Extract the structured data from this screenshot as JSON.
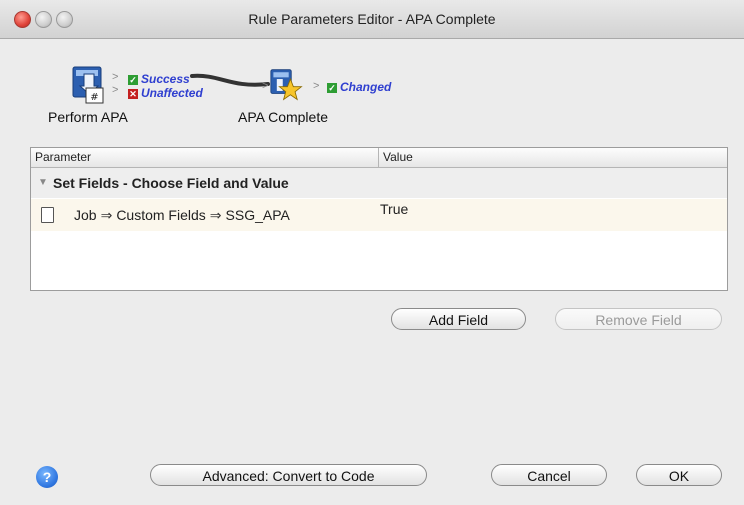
{
  "window": {
    "title": "Rule Parameters Editor - APA Complete"
  },
  "flow": {
    "source_node": "Perform APA",
    "source_outputs": [
      "Success",
      "Unaffected"
    ],
    "target_node": "APA Complete",
    "target_output": "Changed"
  },
  "table": {
    "columns": [
      "Parameter",
      "Value"
    ],
    "group_label": "Set Fields - Choose Field and Value",
    "rows": [
      {
        "path": [
          "Job",
          "Custom Fields",
          "SSG_APA"
        ],
        "value": "True"
      }
    ]
  },
  "buttons": {
    "add_field": "Add Field",
    "remove_field": "Remove Field",
    "advanced": "Advanced: Convert to Code",
    "cancel": "Cancel",
    "ok": "OK",
    "help": "?"
  },
  "colors": {
    "output_link": "#2f3fd0",
    "success_check": "#2e9d33",
    "unaffected_x": "#c42020"
  }
}
